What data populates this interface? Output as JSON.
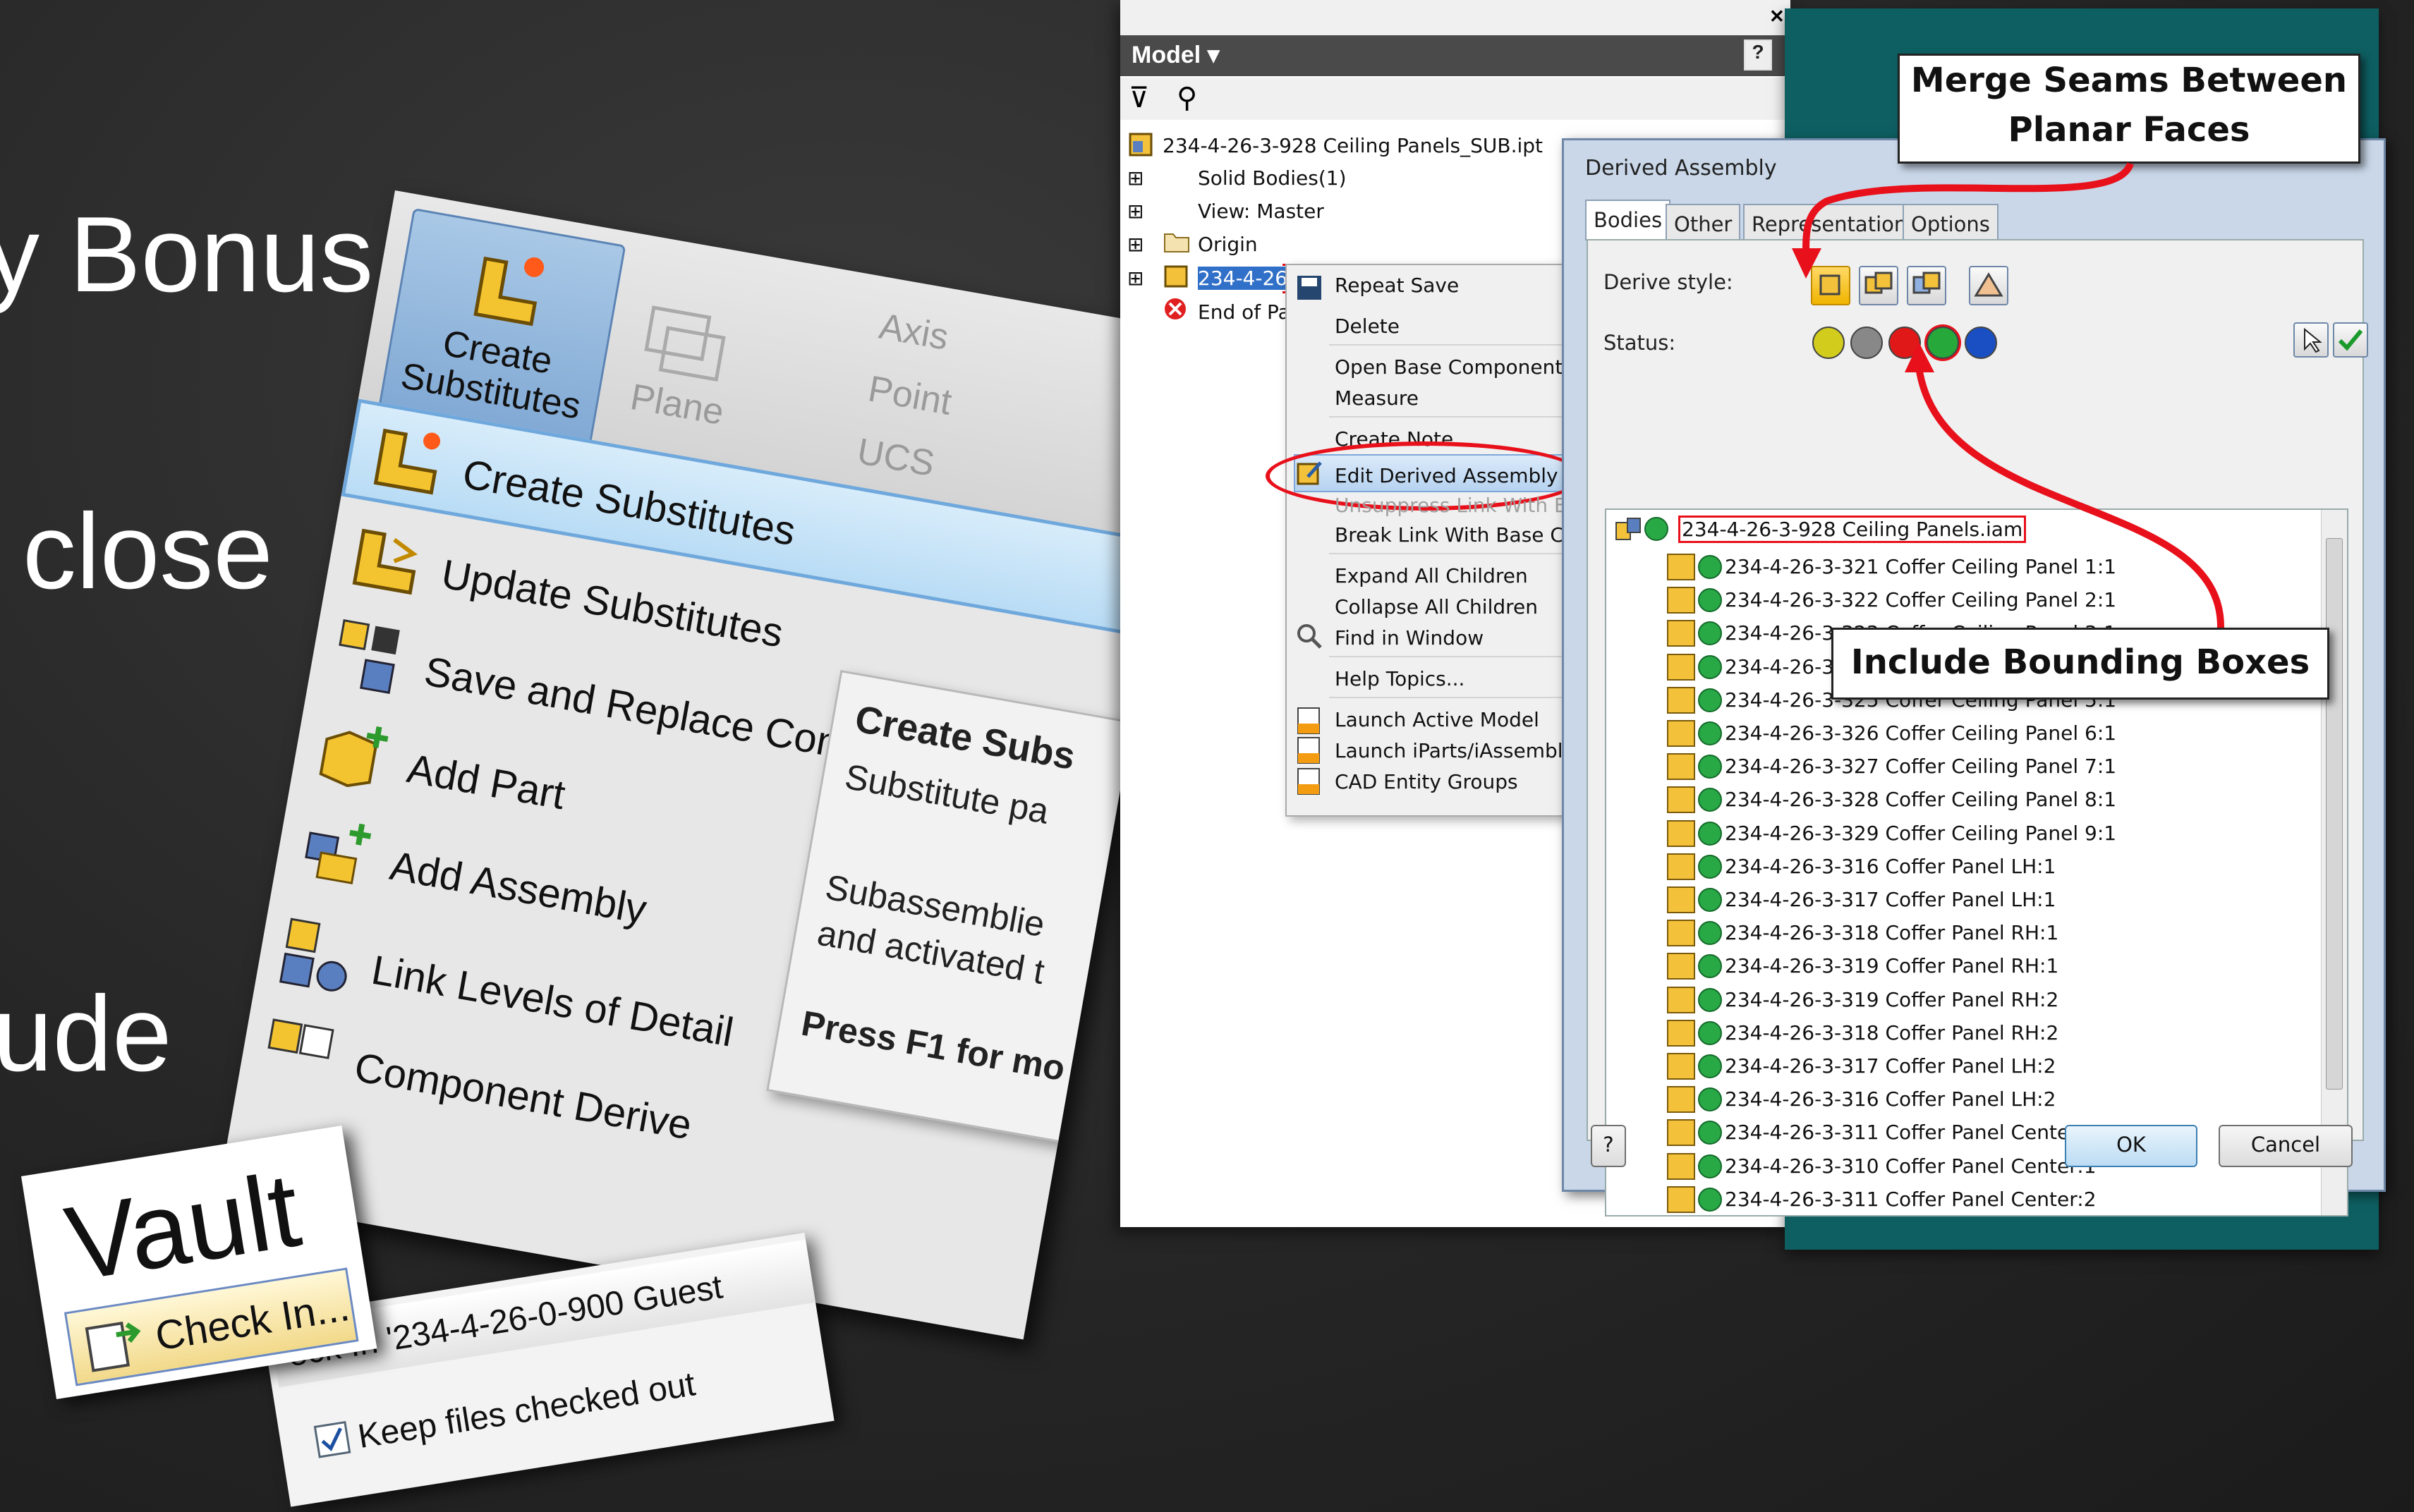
{
  "slide": {
    "line1": "y Bonus",
    "line2": "close",
    "line3": "ude"
  },
  "ribbon": {
    "large_button": "Create Substitutes",
    "plane": "Plane",
    "axis": "Axis",
    "point": "Point",
    "ucs": "UCS",
    "menu": [
      "Create Substitutes",
      "Update Substitutes",
      "Save and Replace Compo",
      "Add Part",
      "Add Assembly",
      "Link Levels of Detail",
      "Component Derive"
    ],
    "tooltip": {
      "title": "Create Subs",
      "line1": "Substitute pa",
      "line2a": "Subassemblie",
      "line2b": "and activated t",
      "footer": "Press F1 for mo"
    }
  },
  "vault": {
    "title": "Vault",
    "check_in": "Check In..."
  },
  "checkin_dialog": {
    "title": "eck In '234-4-26-0-900 Guest",
    "keep": "Keep files checked out"
  },
  "browser": {
    "header": "Model ▾",
    "root": "234-4-26-3-928 Ceiling Panels_SUB.ipt",
    "items": [
      "Solid Bodies(1)",
      "View: Master",
      "Origin",
      "234-4-26-",
      "End of Par"
    ]
  },
  "context_menu": [
    "Repeat Save",
    "Delete",
    "Open Base Component",
    "Measure",
    "Create Note",
    "Edit Derived Assembly",
    "Unsuppress Link With Bas",
    "Break Link With Base Com",
    "Expand All Children",
    "Collapse All Children",
    "Find in Window",
    "Help Topics...",
    "Launch Active Model",
    "Launch iParts/iAssemblies",
    "CAD Entity Groups"
  ],
  "dialog": {
    "title": "Derived Assembly",
    "tabs": [
      "Bodies",
      "Other",
      "Representation",
      "Options"
    ],
    "derive_style": "Derive style:",
    "status": "Status:",
    "root_item": "234-4-26-3-928 Ceiling Panels.iam",
    "rows": [
      "234-4-26-3-321 Coffer Ceiling Panel 1:1",
      "234-4-26-3-322 Coffer Ceiling Panel 2:1",
      "234-4-26-3-323 Coffer Ceiling Panel 3:1",
      "234-4-26-3-324 Coffer Ceiling Panel 4:1",
      "234-4-26-3-325 Coffer Ceiling Panel 5:1",
      "234-4-26-3-326 Coffer Ceiling Panel 6:1",
      "234-4-26-3-327 Coffer Ceiling Panel 7:1",
      "234-4-26-3-328 Coffer Ceiling Panel 8:1",
      "234-4-26-3-329 Coffer Ceiling Panel 9:1",
      "234-4-26-3-316 Coffer Panel LH:1",
      "234-4-26-3-317 Coffer Panel LH:1",
      "234-4-26-3-318 Coffer Panel RH:1",
      "234-4-26-3-319 Coffer Panel RH:1",
      "234-4-26-3-319 Coffer Panel RH:2",
      "234-4-26-3-318 Coffer Panel RH:2",
      "234-4-26-3-317 Coffer Panel LH:2",
      "234-4-26-3-316 Coffer Panel LH:2",
      "234-4-26-3-311 Coffer Panel Center:1",
      "234-4-26-3-310 Coffer Panel Center:1",
      "234-4-26-3-311 Coffer Panel Center:2"
    ],
    "ok": "OK",
    "cancel": "Cancel",
    "help": "?"
  },
  "callouts": {
    "merge1": "Merge Seams Between",
    "merge2": "Planar Faces",
    "bounding": "Include Bounding Boxes"
  },
  "colors": {
    "accent_red": "#e8101a",
    "teal": "#0e5f62",
    "highlight_blue": "#6fa8dc"
  }
}
